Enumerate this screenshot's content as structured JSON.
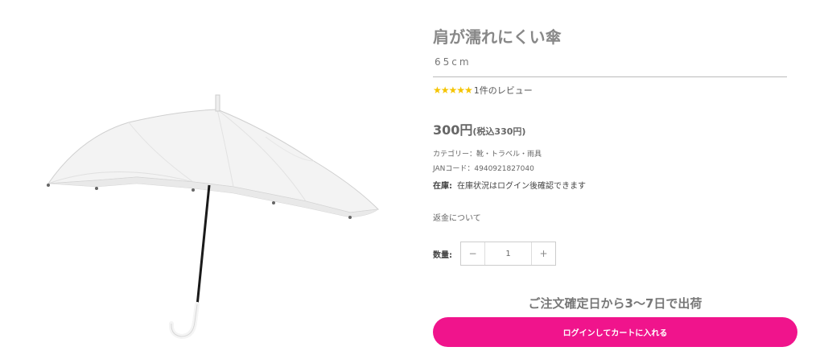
{
  "product": {
    "title": "肩が濡れにくい傘",
    "size": "65cm",
    "stars": "★★★★★",
    "review_text": "1件のレビュー",
    "price": "300円",
    "price_tax": "(税込330円)",
    "category": "カテゴリー：靴・トラベル・雨具",
    "jan": "JANコード：4940921827040",
    "stock_label": "在庫:",
    "stock_value": "在庫状況はログイン後確認できます",
    "refund_link": "返金について"
  },
  "quantity": {
    "label": "数量:",
    "minus": "−",
    "value": "1",
    "plus": "+"
  },
  "shipping_text": "ご注文確定日から3〜7日で出荷",
  "cart_button": "ログインしてカートに入れる",
  "colors": {
    "accent": "#f0148c",
    "star": "#f5c400"
  }
}
